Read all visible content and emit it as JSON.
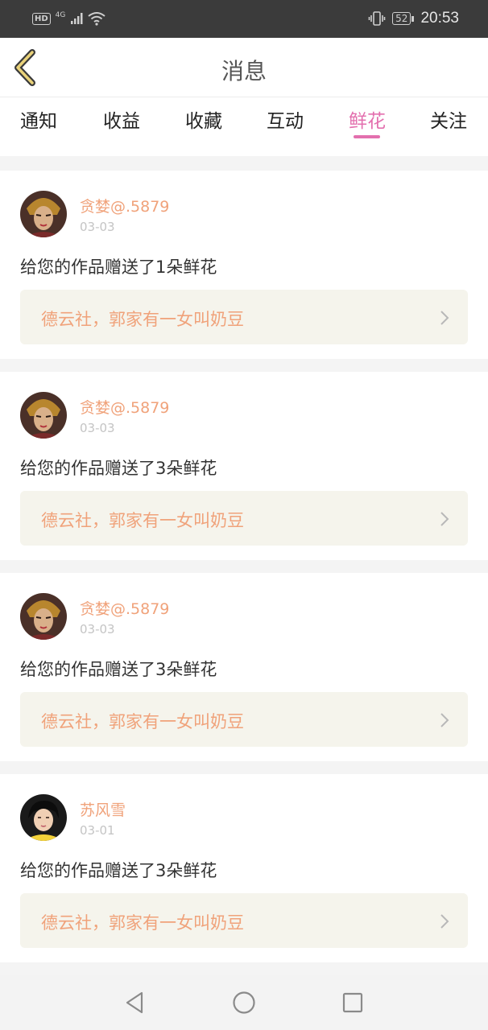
{
  "status_bar": {
    "hd": "HD",
    "network": "4G",
    "battery": "52",
    "time": "20:53"
  },
  "header": {
    "title": "消息"
  },
  "tabs": [
    {
      "label": "通知"
    },
    {
      "label": "收益"
    },
    {
      "label": "收藏"
    },
    {
      "label": "互动"
    },
    {
      "label": "鲜花"
    },
    {
      "label": "关注"
    }
  ],
  "active_tab": "鲜花",
  "colors": {
    "accent": "#e36fae",
    "name_color": "#f0a27a",
    "link_bg": "#f5f4ec",
    "status_bar": "#3b3b3b"
  },
  "messages": [
    {
      "user": "贪婪@.5879",
      "date": "03-03",
      "text": "给您的作品赠送了1朵鲜花",
      "work": "德云社，郭家有一女叫奶豆",
      "avatar": "opera-mask-avatar"
    },
    {
      "user": "贪婪@.5879",
      "date": "03-03",
      "text": "给您的作品赠送了3朵鲜花",
      "work": "德云社，郭家有一女叫奶豆",
      "avatar": "opera-mask-avatar"
    },
    {
      "user": "贪婪@.5879",
      "date": "03-03",
      "text": "给您的作品赠送了3朵鲜花",
      "work": "德云社，郭家有一女叫奶豆",
      "avatar": "opera-mask-avatar"
    },
    {
      "user": "苏风雪",
      "date": "03-01",
      "text": "给您的作品赠送了3朵鲜花",
      "work": "德云社，郭家有一女叫奶豆",
      "avatar": "young-man-avatar"
    }
  ],
  "nav": {
    "back_icon": "triangle-back-icon",
    "home_icon": "circle-home-icon",
    "recents_icon": "square-recents-icon"
  }
}
